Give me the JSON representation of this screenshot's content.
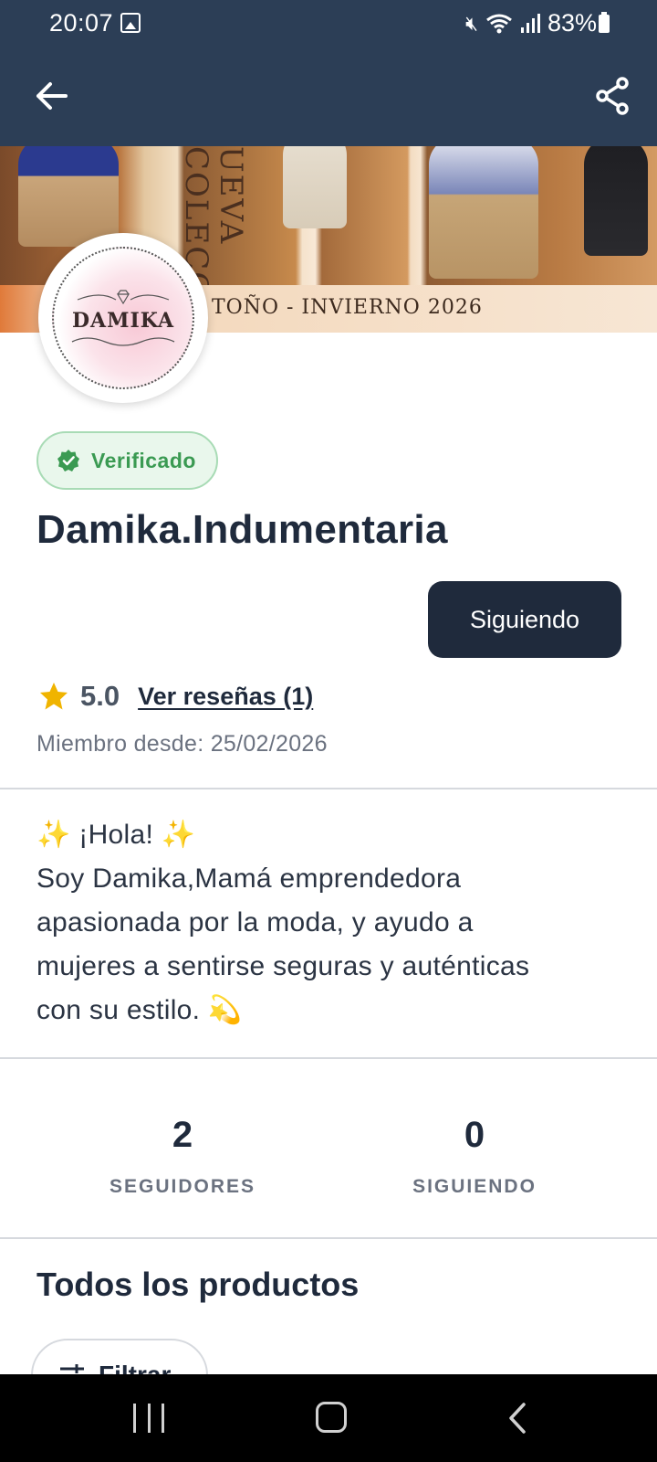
{
  "status_bar": {
    "time": "20:07",
    "battery": "83%",
    "icons": [
      "image-icon",
      "mute-icon",
      "wifi-icon",
      "signal-icon",
      "battery-icon"
    ]
  },
  "app_bar": {
    "icons": [
      "arrow-left-icon",
      "share-icon"
    ]
  },
  "banner": {
    "vertical_text": "UEVA COLECC",
    "caption": "TOÑO - INVIERNO 2026"
  },
  "avatar": {
    "logo_text": "DAMIKA"
  },
  "profile": {
    "verified_label": "Verificado",
    "store_name": "Damika.Indumentaria",
    "follow_button_label": "Siguiendo",
    "rating": "5.0",
    "reviews_link": "Ver reseñas (1)",
    "member_since": "Miembro desde: 25/02/2026"
  },
  "bio": {
    "lines": [
      "✨ ¡Hola! ✨",
      "Soy Damika,Mamá emprendedora",
      "apasionada por la moda, y ayudo a",
      "mujeres a sentirse seguras y auténticas",
      "con su estilo. 💫"
    ]
  },
  "stats": {
    "followers_count": "2",
    "followers_label": "SEGUIDORES",
    "following_count": "0",
    "following_label": "SIGUIENDO"
  },
  "products": {
    "section_title": "Todos los productos",
    "filter_label": "Filtrar"
  },
  "colors": {
    "header_bg": "#2c3e56",
    "primary_dark": "#1f2a3c",
    "verified_green": "#3a9a52",
    "star_gold": "#f0b400"
  }
}
